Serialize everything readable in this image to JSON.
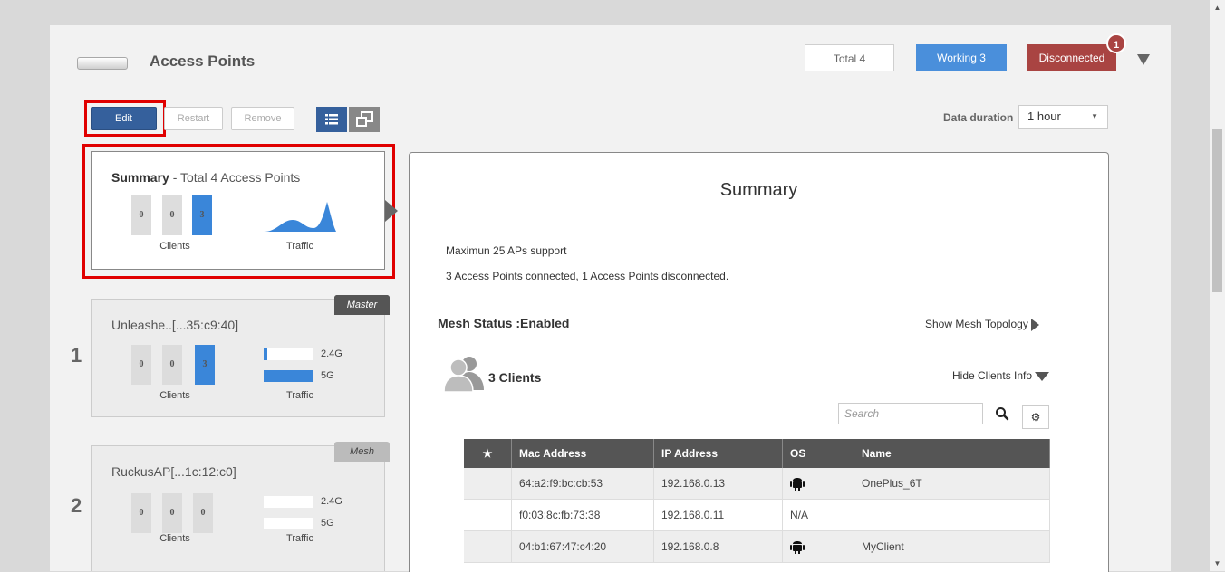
{
  "header": {
    "title": "Access Points",
    "total_label": "Total 4",
    "working_label": "Working 3",
    "disconnected_label": "Disconnected",
    "disconnected_badge": "1"
  },
  "toolbar": {
    "edit": "Edit",
    "restart": "Restart",
    "remove": "Remove",
    "data_duration_label": "Data duration",
    "data_duration_value": "1 hour"
  },
  "summary_card": {
    "title_bold": "Summary",
    "title_rest": " - Total 4 Access Points",
    "counts": [
      "0",
      "0",
      "3"
    ],
    "clients_label": "Clients",
    "traffic_label": "Traffic"
  },
  "ap_cards": [
    {
      "index": "1",
      "name": "Unleashe..[...35:c9:40]",
      "tag": "Master",
      "counts": [
        "0",
        "0",
        "3"
      ],
      "band_24": "2.4G",
      "band_5": "5G",
      "traffic_24": 0.08,
      "traffic_5": 0.98,
      "clients_label": "Clients",
      "traffic_label": "Traffic"
    },
    {
      "index": "2",
      "name": "RuckusAP[...1c:12:c0]",
      "tag": "Mesh",
      "counts": [
        "0",
        "0",
        "0"
      ],
      "band_24": "2.4G",
      "band_5": "5G",
      "traffic_24": 0,
      "traffic_5": 0,
      "clients_label": "Clients",
      "traffic_label": "Traffic"
    }
  ],
  "detail": {
    "title": "Summary",
    "max_support": "Maximun 25 APs support",
    "connection_info": "3 Access Points connected, 1 Access Points disconnected.",
    "mesh_status": "Mesh Status :Enabled",
    "show_mesh": "Show Mesh Topology",
    "clients_count": "3 Clients",
    "hide_clients": "Hide Clients Info",
    "search_placeholder": "Search"
  },
  "clients_table": {
    "columns": [
      "Mac Address",
      "IP Address",
      "OS",
      "Name"
    ],
    "rows": [
      {
        "mac": "64:a2:f9:bc:cb:53",
        "ip": "192.168.0.13",
        "os": "android-icon",
        "name": "OnePlus_6T"
      },
      {
        "mac": "f0:03:8c:fb:73:38",
        "ip": "192.168.0.11",
        "os": "N/A",
        "name": ""
      },
      {
        "mac": "04:b1:67:47:c4:20",
        "ip": "192.168.0.8",
        "os": "android-icon",
        "name": "MyClient"
      }
    ]
  },
  "colors": {
    "accent_blue": "#35609c",
    "working_blue": "#4a8fdb",
    "disconnected_red": "#a94442",
    "highlight_red": "#e00000"
  }
}
